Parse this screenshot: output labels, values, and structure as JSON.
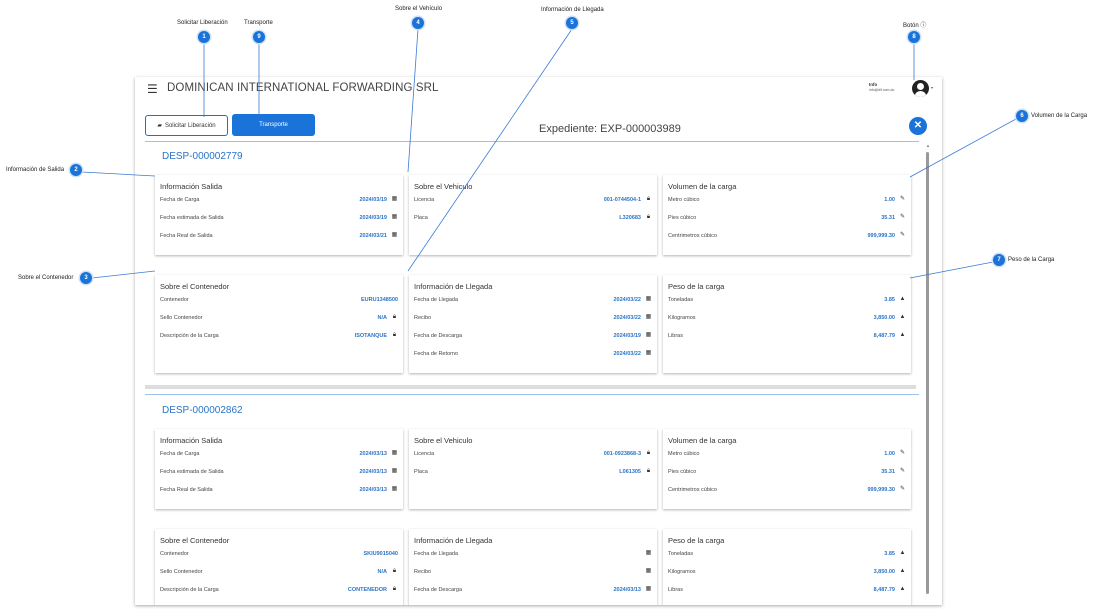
{
  "annotations": [
    {
      "num": "1",
      "label": "Solicitar Liberación"
    },
    {
      "num": "9",
      "label": "Transporte"
    },
    {
      "num": "4",
      "label": "Sobre el Vehículo"
    },
    {
      "num": "5",
      "label": "Información de Llegada"
    },
    {
      "num": "8",
      "label": "Botón ⓘ"
    },
    {
      "num": "6",
      "label": "Volumen de la Carga"
    },
    {
      "num": "2",
      "label": "Información de Salida"
    },
    {
      "num": "3",
      "label": "Sobre el Contenedor"
    },
    {
      "num": "7",
      "label": "Peso de la Carga"
    }
  ],
  "header": {
    "company": "DOMINICAN INTERNATIONAL FORWARDING SRL",
    "user_name": "Info",
    "user_email": "info@dif.com.do"
  },
  "toolbar": {
    "solicitar_label": "Solicitar Liberación",
    "transporte_label": "Transporte"
  },
  "expediente": "Expediente: EXP-000003989",
  "despachos": [
    {
      "id": "DESP-000002779",
      "cards": [
        {
          "title": "Información Salida",
          "rows": [
            {
              "label": "Fecha de Carga",
              "value": "2024/03/19",
              "icon": "calendar-icon"
            },
            {
              "label": "Fecha estimada de Salida",
              "value": "2024/03/19",
              "icon": "calendar-icon"
            },
            {
              "label": "Fecha Real de Salida",
              "value": "2024/03/21",
              "icon": "calendar-icon"
            }
          ]
        },
        {
          "title": "Sobre el Vehiculo",
          "rows": [
            {
              "label": "Licencia",
              "value": "001-0744504-1",
              "icon": "lock-icon"
            },
            {
              "label": "Placa",
              "value": "L320683",
              "icon": "lock-icon"
            }
          ]
        },
        {
          "title": "Volumen de la carga",
          "rows": [
            {
              "label": "Metro cúbico",
              "value": "1.00",
              "icon": "pencil-icon"
            },
            {
              "label": "Pies cúbico",
              "value": "35.31",
              "icon": "pencil-icon"
            },
            {
              "label": "Centrimetros cúbico",
              "value": "999,999.30",
              "icon": "pencil-icon"
            }
          ]
        },
        {
          "title": "Sobre el Contenedor",
          "rows": [
            {
              "label": "Contenedor",
              "value": "EURU1348500",
              "icon": ""
            },
            {
              "label": "Sello Contenedor",
              "value": "N/A",
              "icon": "lock-icon"
            },
            {
              "label": "Descripción de la Carga",
              "value": "ISOTANQUE",
              "icon": "lock-icon"
            }
          ]
        },
        {
          "title": "Información de Llegada",
          "rows": [
            {
              "label": "Fecha de Llegada",
              "value": "2024/03/22",
              "icon": "calendar-icon"
            },
            {
              "label": "Recibo",
              "value": "2024/03/22",
              "icon": "calendar-icon"
            },
            {
              "label": "Fecha de Descarga",
              "value": "2024/03/19",
              "icon": "calendar-icon"
            },
            {
              "label": "Fecha de Retorno",
              "value": "2024/03/22",
              "icon": "calendar-icon"
            }
          ]
        },
        {
          "title": "Peso de la carga",
          "rows": [
            {
              "label": "Toneladas",
              "value": "3.85",
              "icon": "weight-icon"
            },
            {
              "label": "Kilogramos",
              "value": "3,850.00",
              "icon": "weight-icon"
            },
            {
              "label": "Libras",
              "value": "8,487.79",
              "icon": "weight-icon"
            }
          ]
        }
      ]
    },
    {
      "id": "DESP-000002862",
      "cards": [
        {
          "title": "Información Salida",
          "rows": [
            {
              "label": "Fecha de Carga",
              "value": "2024/03/13",
              "icon": "calendar-icon"
            },
            {
              "label": "Fecha estimada de Salida",
              "value": "2024/03/13",
              "icon": "calendar-icon"
            },
            {
              "label": "Fecha Real de Salida",
              "value": "2024/03/13",
              "icon": "calendar-icon"
            }
          ]
        },
        {
          "title": "Sobre el Vehiculo",
          "rows": [
            {
              "label": "Licencia",
              "value": "001-0923868-3",
              "icon": "lock-icon"
            },
            {
              "label": "Placa",
              "value": "L061305",
              "icon": "lock-icon"
            }
          ]
        },
        {
          "title": "Volumen de la carga",
          "rows": [
            {
              "label": "Metro cúbico",
              "value": "1.00",
              "icon": "pencil-icon"
            },
            {
              "label": "Pies cúbico",
              "value": "35.31",
              "icon": "pencil-icon"
            },
            {
              "label": "Centrimetros cúbico",
              "value": "999,999.30",
              "icon": "pencil-icon"
            }
          ]
        },
        {
          "title": "Sobre el Contenedor",
          "rows": [
            {
              "label": "Contenedor",
              "value": "SKIU9015040",
              "icon": ""
            },
            {
              "label": "Sello Contenedor",
              "value": "N/A",
              "icon": "lock-icon"
            },
            {
              "label": "Descripción de la Carga",
              "value": "CONTENEDOR",
              "icon": "lock-icon"
            }
          ]
        },
        {
          "title": "Información de Llegada",
          "rows": [
            {
              "label": "Fecha de Llegada",
              "value": "",
              "icon": "calendar-icon"
            },
            {
              "label": "Recibo",
              "value": "",
              "icon": "calendar-icon"
            },
            {
              "label": "Fecha de Descarga",
              "value": "2024/03/13",
              "icon": "calendar-icon"
            }
          ]
        },
        {
          "title": "Peso de la carga",
          "rows": [
            {
              "label": "Toneladas",
              "value": "3.85",
              "icon": "weight-icon"
            },
            {
              "label": "Kilogramos",
              "value": "3,850.00",
              "icon": "weight-icon"
            },
            {
              "label": "Libras",
              "value": "8,487.79",
              "icon": "weight-icon"
            }
          ]
        }
      ]
    }
  ],
  "colors": {
    "accent": "#1a73d9",
    "link": "#2a74c6",
    "separator": "#9cc2ea"
  }
}
